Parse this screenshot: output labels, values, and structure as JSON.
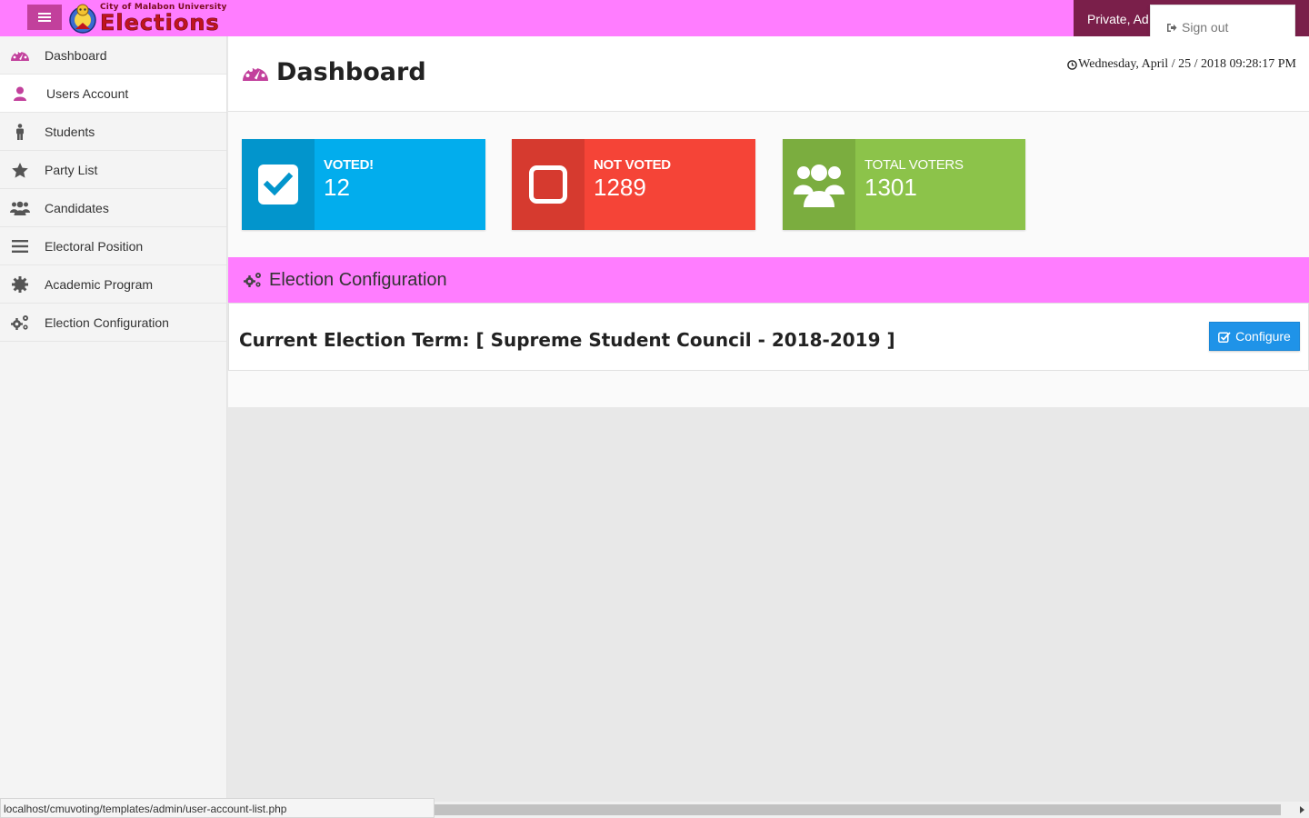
{
  "brand": {
    "subtitle": "City of Malabon University",
    "title": "Elections"
  },
  "topbar": {
    "user_label": "Private, Ad",
    "menu": {
      "signout": "Sign out"
    }
  },
  "sidebar": {
    "items": [
      {
        "label": "Dashboard",
        "icon": "dashboard-icon"
      },
      {
        "label": "Users Account",
        "icon": "user-icon"
      },
      {
        "label": "Students",
        "icon": "male-icon"
      },
      {
        "label": "Party List",
        "icon": "star-icon"
      },
      {
        "label": "Candidates",
        "icon": "users-icon"
      },
      {
        "label": "Electoral Position",
        "icon": "list-icon"
      },
      {
        "label": "Academic Program",
        "icon": "gear-icon"
      },
      {
        "label": "Election Configuration",
        "icon": "gears-icon"
      }
    ]
  },
  "page": {
    "title": "Dashboard",
    "datetime": "Wednesday, April / 25 / 2018 09:28:17 PM"
  },
  "stats": {
    "voted": {
      "label": "VOTED!",
      "value": "12",
      "color": "#02aded"
    },
    "not_voted": {
      "label": "NOT VOTED",
      "value": "1289",
      "color": "#f54437"
    },
    "total": {
      "label": "TOTAL VOTERS",
      "value": "1301",
      "color": "#8cc34a"
    }
  },
  "config": {
    "header": "Election Configuration",
    "current_term": "Current Election Term: [ Supreme Student Council - 2018-2019 ]",
    "button": "Configure"
  },
  "statusbar": {
    "url": "localhost/cmuvoting/templates/admin/user-account-list.php"
  },
  "colors": {
    "topbar": "#ff7dff",
    "accent": "#c2409c",
    "user_tab": "#7a1f4a",
    "button": "#1f93e8"
  }
}
